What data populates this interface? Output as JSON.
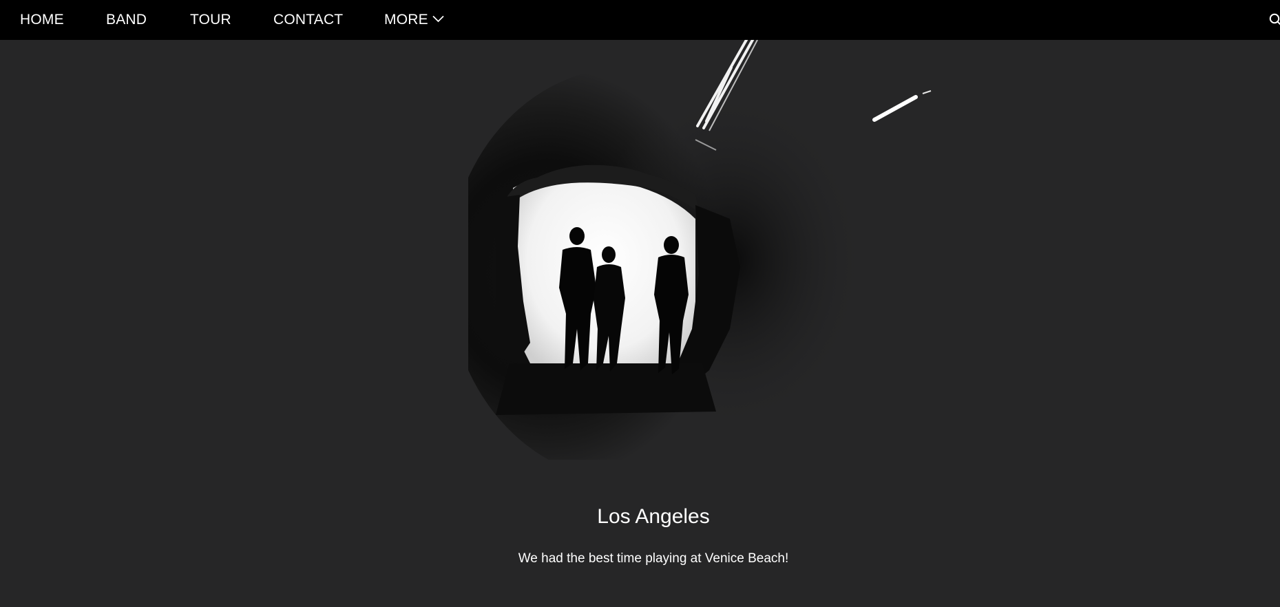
{
  "nav": {
    "items": [
      {
        "label": "HOME"
      },
      {
        "label": "BAND"
      },
      {
        "label": "TOUR"
      },
      {
        "label": "CONTACT"
      },
      {
        "label": "MORE"
      }
    ],
    "more_icon": "chevron-down-icon",
    "search_icon": "search-icon"
  },
  "slide": {
    "image": "silhouettes-of-three-people-walking-out-of-dark-tunnel",
    "title": "Los Angeles",
    "text": "We had the best time playing at Venice Beach!"
  },
  "colors": {
    "navbar_bg": "#000000",
    "page_bg": "#262627",
    "text": "#ffffff"
  }
}
